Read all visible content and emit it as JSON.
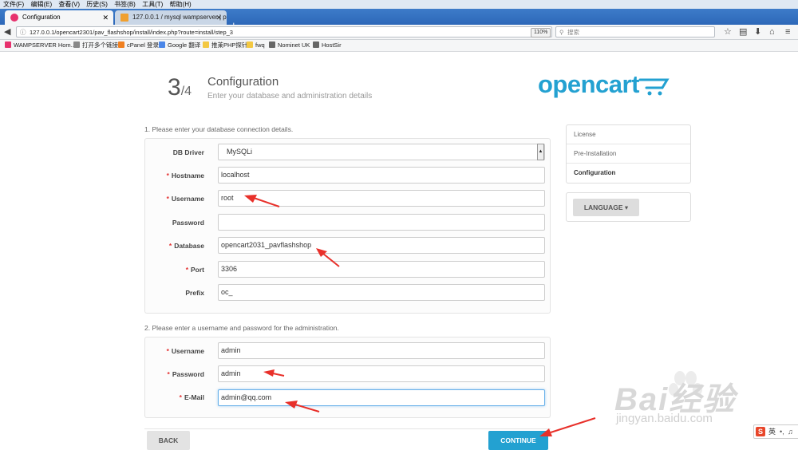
{
  "browser": {
    "menu": [
      "文件(F)",
      "编辑(E)",
      "查看(V)",
      "历史(S)",
      "书签(B)",
      "工具(T)",
      "帮助(H)"
    ],
    "tabs": [
      {
        "title": "Configuration",
        "active": true,
        "icon_color": "#e7316d"
      },
      {
        "title": "127.0.0.1 / mysql wampserver | p",
        "active": false,
        "icon_color": "#f0a030"
      }
    ],
    "new_tab": "+",
    "url": "127.0.0.1/opencart2301/pav_flashshop/install/index.php?route=install/step_3",
    "zoom": "110%",
    "search_placeholder": "搜索",
    "bookmarks": [
      {
        "label": "WAMPSERVER Hom...",
        "icon_color": "#e7316d"
      },
      {
        "label": "打开多个链接",
        "icon_color": "#888888"
      },
      {
        "label": "cPanel 登录",
        "icon_color": "#f08020"
      },
      {
        "label": "Google 翻译",
        "icon_color": "#4a86e8"
      },
      {
        "label": "推莱PHP探针",
        "icon_color": "#f3c842"
      },
      {
        "label": "fwq",
        "icon_color": "#f3c842"
      },
      {
        "label": "Nominet UK",
        "icon_color": "#666666"
      },
      {
        "label": "HostSir",
        "icon_color": "#666666"
      }
    ]
  },
  "header": {
    "step_current": "3",
    "step_total": "/4",
    "title": "Configuration",
    "subtitle": "Enter your database and administration details",
    "logo_text": "opencart"
  },
  "db_section": {
    "heading": "1. Please enter your database connection details.",
    "fields": [
      {
        "label": "DB Driver",
        "required": "",
        "value": "MySQLi"
      },
      {
        "label": "Hostname",
        "required": "*",
        "value": "localhost"
      },
      {
        "label": "Username",
        "required": "*",
        "value": "root"
      },
      {
        "label": "Password",
        "required": "",
        "value": ""
      },
      {
        "label": "Database",
        "required": "*",
        "value": "opencart2031_pavflashshop"
      },
      {
        "label": "Port",
        "required": "*",
        "value": "3306"
      },
      {
        "label": "Prefix",
        "required": "",
        "value": "oc_"
      }
    ]
  },
  "admin_section": {
    "heading": "2. Please enter a username and password for the administration.",
    "fields": [
      {
        "label": "Username",
        "required": "*",
        "value": "admin"
      },
      {
        "label": "Password",
        "required": "*",
        "value": "admin"
      },
      {
        "label": "E-Mail",
        "required": "*",
        "value": "admin@qq.com"
      }
    ]
  },
  "buttons": {
    "back": "BACK",
    "continue": "CONTINUE"
  },
  "sidebar": {
    "steps": [
      "License",
      "Pre-Installation",
      "Configuration"
    ],
    "active_step": "Configuration",
    "language": "LANGUAGE"
  },
  "overlay": {
    "watermark": "Bai经验",
    "watermark_sub": "jingyan.baidu.com",
    "ime_lang": "英"
  },
  "colors": {
    "accent": "#23a1d1",
    "required": "#e42f2f",
    "annotation": "#e8302a"
  }
}
